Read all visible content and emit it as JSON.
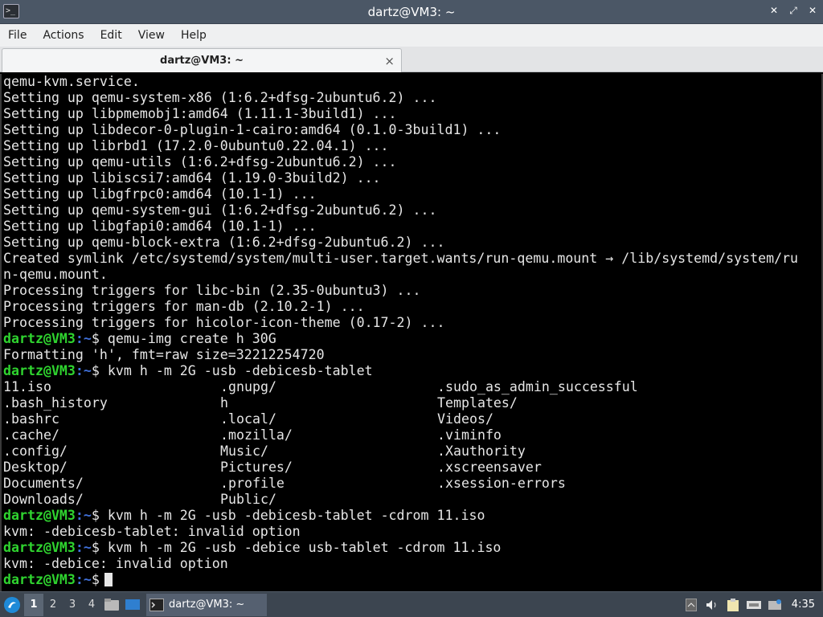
{
  "window": {
    "title": "dartz@VM3: ~",
    "controls": {
      "minimize": "✕",
      "restore": "⤡",
      "close": "✕"
    }
  },
  "menu": [
    "File",
    "Actions",
    "Edit",
    "View",
    "Help"
  ],
  "tab": {
    "label": "dartz@VM3: ~",
    "close": "×"
  },
  "prompt": {
    "user": "dartz@VM3",
    "path": ":~",
    "symbol": "$"
  },
  "terminal": {
    "output_lines": [
      "qemu-kvm.service.",
      "Setting up qemu-system-x86 (1:6.2+dfsg-2ubuntu6.2) ...",
      "Setting up libpmemobj1:amd64 (1.11.1-3build1) ...",
      "Setting up libdecor-0-plugin-1-cairo:amd64 (0.1.0-3build1) ...",
      "Setting up librbd1 (17.2.0-0ubuntu0.22.04.1) ...",
      "Setting up qemu-utils (1:6.2+dfsg-2ubuntu6.2) ...",
      "Setting up libiscsi7:amd64 (1.19.0-3build2) ...",
      "Setting up libgfrpc0:amd64 (10.1-1) ...",
      "Setting up qemu-system-gui (1:6.2+dfsg-2ubuntu6.2) ...",
      "Setting up libgfapi0:amd64 (10.1-1) ...",
      "Setting up qemu-block-extra (1:6.2+dfsg-2ubuntu6.2) ...",
      "Created symlink /etc/systemd/system/multi-user.target.wants/run-qemu.mount → /lib/systemd/system/ru",
      "n-qemu.mount.",
      "Processing triggers for libc-bin (2.35-0ubuntu3) ...",
      "Processing triggers for man-db (2.10.2-1) ...",
      "Processing triggers for hicolor-icon-theme (0.17-2) ..."
    ],
    "cmd1": " qemu-img create h 30G",
    "cmd1_out": "Formatting 'h', fmt=raw size=32212254720",
    "cmd2": " kvm h -m 2G -usb -debicesb-tablet",
    "completion_rows": [
      [
        "11.iso",
        ".gnupg/",
        ".sudo_as_admin_successful"
      ],
      [
        ".bash_history",
        "h",
        "Templates/"
      ],
      [
        ".bashrc",
        ".local/",
        "Videos/"
      ],
      [
        ".cache/",
        ".mozilla/",
        ".viminfo"
      ],
      [
        ".config/",
        "Music/",
        ".Xauthority"
      ],
      [
        "Desktop/",
        "Pictures/",
        ".xscreensaver"
      ],
      [
        "Documents/",
        ".profile",
        ".xsession-errors"
      ],
      [
        "Downloads/",
        "Public/",
        ""
      ]
    ],
    "cmd3": " kvm h -m 2G -usb -debicesb-tablet -cdrom 11.iso",
    "cmd3_out": "kvm: -debicesb-tablet: invalid option",
    "cmd4": " kvm h -m 2G -usb -debice usb-tablet -cdrom 11.iso",
    "cmd4_out": "kvm: -debice: invalid option",
    "cmd5": " "
  },
  "taskbar": {
    "workspaces": [
      "1",
      "2",
      "3",
      "4"
    ],
    "active_workspace": "1",
    "task_label": "dartz@VM3: ~",
    "clock": "4:35"
  },
  "colors": {
    "titlebar": "#4b5766",
    "prompt_user": "#2fd42f",
    "prompt_path": "#3f6fd8",
    "taskbar": "#3c4550"
  }
}
